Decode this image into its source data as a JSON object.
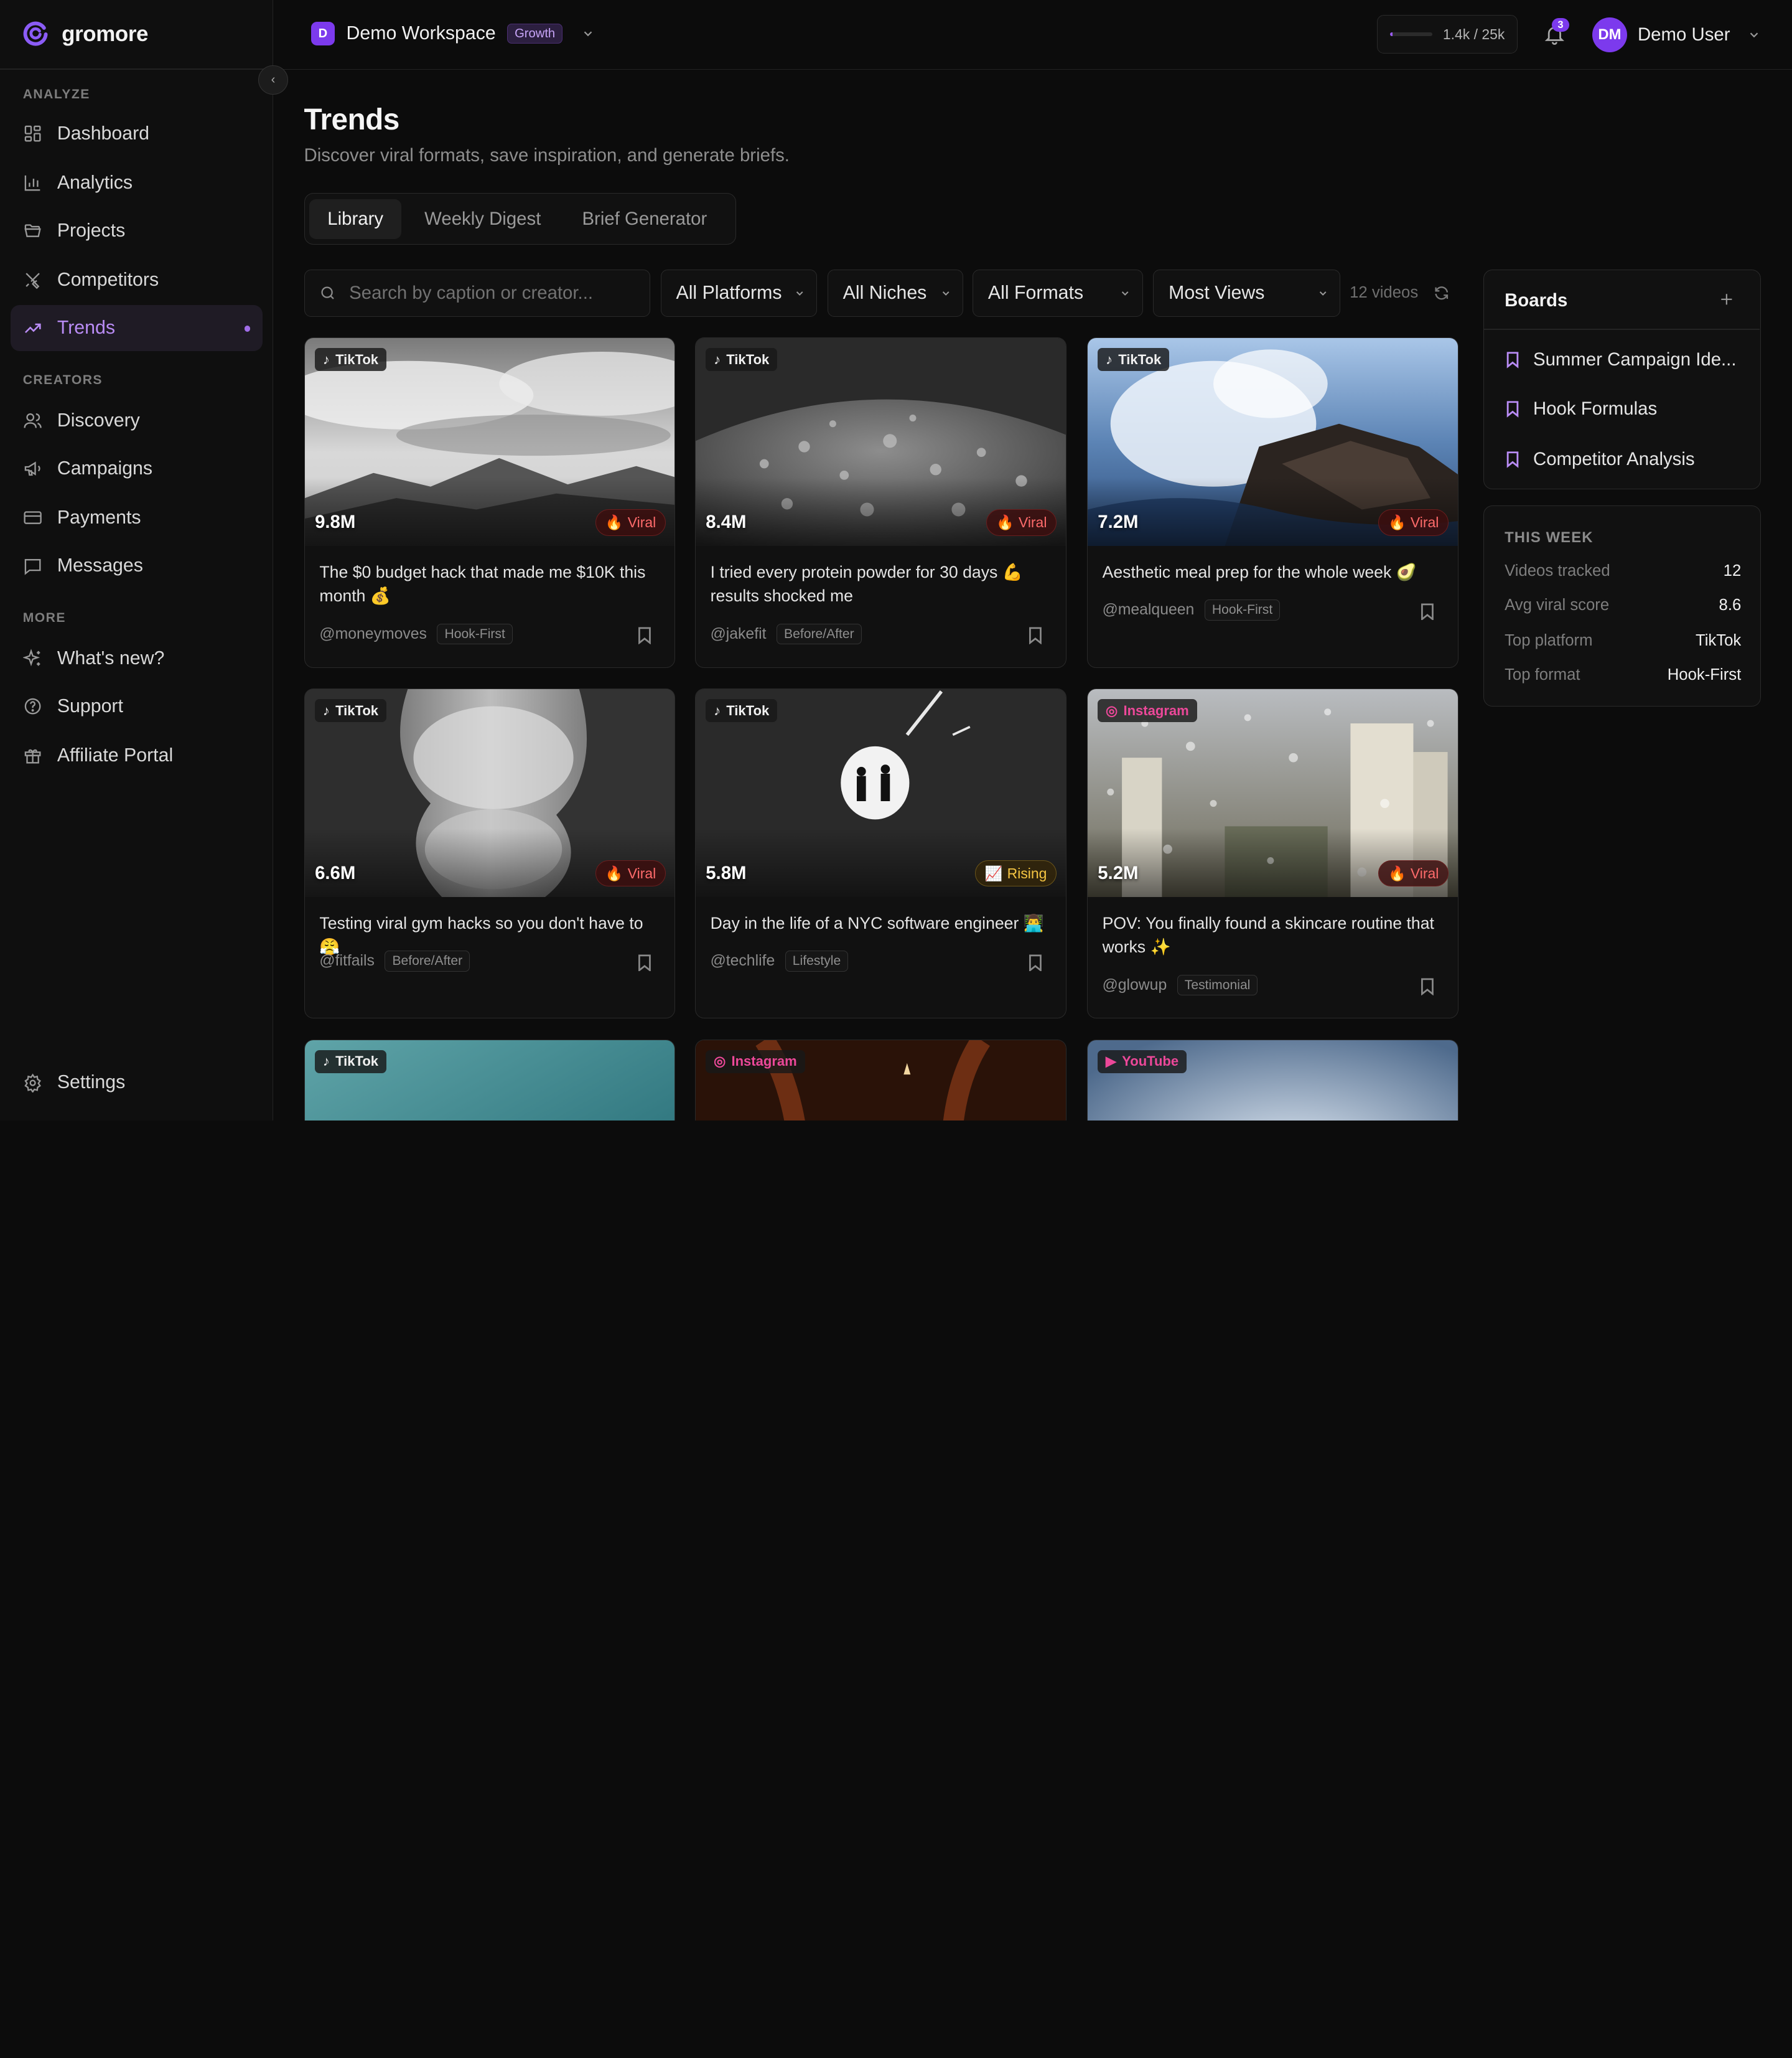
{
  "brand": {
    "name": "gromore"
  },
  "sidebar": {
    "sections": [
      {
        "label": "ANALYZE",
        "items": [
          {
            "label": "Dashboard",
            "icon": "dashboard-icon"
          },
          {
            "label": "Analytics",
            "icon": "bar-chart-icon"
          },
          {
            "label": "Projects",
            "icon": "folder-icon"
          },
          {
            "label": "Competitors",
            "icon": "crossed-swords-icon"
          },
          {
            "label": "Trends",
            "icon": "trending-up-icon",
            "active": true
          }
        ]
      },
      {
        "label": "CREATORS",
        "items": [
          {
            "label": "Discovery",
            "icon": "users-icon"
          },
          {
            "label": "Campaigns",
            "icon": "megaphone-icon"
          },
          {
            "label": "Payments",
            "icon": "credit-card-icon"
          },
          {
            "label": "Messages",
            "icon": "message-icon"
          }
        ]
      },
      {
        "label": "MORE",
        "items": [
          {
            "label": "What's new?",
            "icon": "sparkles-icon"
          },
          {
            "label": "Support",
            "icon": "help-circle-icon"
          },
          {
            "label": "Affiliate Portal",
            "icon": "gift-icon"
          }
        ]
      }
    ],
    "settings_label": "Settings"
  },
  "header": {
    "workspace": {
      "initial": "D",
      "name": "Demo Workspace",
      "plan": "Growth"
    },
    "usage": {
      "text": "1.4k / 25k",
      "fraction": 0.056
    },
    "notifications": {
      "count": "3"
    },
    "user": {
      "initials": "DM",
      "name": "Demo User"
    }
  },
  "page": {
    "title": "Trends",
    "subtitle": "Discover viral formats, save inspiration, and generate briefs.",
    "tabs": [
      "Library",
      "Weekly Digest",
      "Brief Generator"
    ],
    "active_tab": "Library"
  },
  "filters": {
    "search_placeholder": "Search by caption or creator...",
    "platform": "All Platforms",
    "niche": "All Niches",
    "format": "All Formats",
    "sort": "Most Views",
    "count_text": "12 videos"
  },
  "videos": [
    {
      "platform": "TikTok",
      "views": "9.8M",
      "status": "Viral",
      "caption": "The $0 budget hack that made me $10K this month 💰",
      "creator": "@moneymoves",
      "format": "Hook-First"
    },
    {
      "platform": "TikTok",
      "views": "8.4M",
      "status": "Viral",
      "caption": "I tried every protein powder for 30 days 💪 results shocked me",
      "creator": "@jakefit",
      "format": "Before/After"
    },
    {
      "platform": "TikTok",
      "views": "7.2M",
      "status": "Viral",
      "caption": "Aesthetic meal prep for the whole week 🥑",
      "creator": "@mealqueen",
      "format": "Hook-First"
    },
    {
      "platform": "TikTok",
      "views": "6.6M",
      "status": "Viral",
      "caption": "Testing viral gym hacks so you don't have to 😤",
      "creator": "@fitfails",
      "format": "Before/After"
    },
    {
      "platform": "TikTok",
      "views": "5.8M",
      "status": "Rising",
      "caption": "Day in the life of a NYC software engineer 👨‍💻",
      "creator": "@techlife",
      "format": "Lifestyle"
    },
    {
      "platform": "Instagram",
      "views": "5.2M",
      "status": "Viral",
      "caption": "POV: You finally found a skincare routine that works ✨",
      "creator": "@glowup",
      "format": "Testimonial"
    },
    {
      "platform": "TikTok"
    },
    {
      "platform": "Instagram"
    },
    {
      "platform": "YouTube"
    }
  ],
  "boards": {
    "title": "Boards",
    "items": [
      "Summer Campaign Ide...",
      "Hook Formulas",
      "Competitor Analysis"
    ]
  },
  "this_week": {
    "title": "THIS WEEK",
    "rows": [
      {
        "label": "Videos tracked",
        "value": "12"
      },
      {
        "label": "Avg viral score",
        "value": "8.6"
      },
      {
        "label": "Top platform",
        "value": "TikTok"
      },
      {
        "label": "Top format",
        "value": "Hook-First"
      }
    ]
  },
  "colors": {
    "accent": "#7c3aed",
    "accent_text": "#b98cf5",
    "viral": "#ff6b6b",
    "rising": "#f5c542",
    "instagram": "#ec4899"
  }
}
